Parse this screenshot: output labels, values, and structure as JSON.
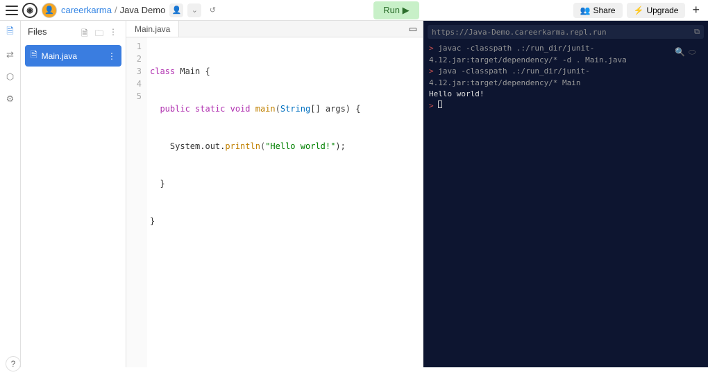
{
  "header": {
    "owner": "careerkarma",
    "project": "Java Demo",
    "run_label": "Run ▶",
    "share_label": "Share",
    "upgrade_label": "Upgrade"
  },
  "sidebar": {
    "title": "Files",
    "file": "Main.java"
  },
  "editor": {
    "tab": "Main.java",
    "lines": [
      "1",
      "2",
      "3",
      "4",
      "5"
    ],
    "code": {
      "l1a": "class",
      "l1b": " Main {",
      "l2a": "  public static void",
      "l2b": " main",
      "l2c": "(",
      "l2d": "String",
      "l2e": "[] args) {",
      "l3a": "    System.out.",
      "l3b": "println",
      "l3c": "(",
      "l3d": "\"Hello world!\"",
      "l3e": ");",
      "l4": "  }",
      "l5": "}"
    }
  },
  "console": {
    "url": "https://Java-Demo.careerkarma.repl.run",
    "line1_prompt": "> ",
    "line1": "javac -classpath .:/run_dir/junit-4.12.jar:target/dependency/* -d . Main.java",
    "line2_prompt": "> ",
    "line2": "java -classpath .:/run_dir/junit-4.12.jar:target/dependency/* Main",
    "line3": "Hello world!",
    "line4_prompt": "> "
  },
  "help": "?"
}
